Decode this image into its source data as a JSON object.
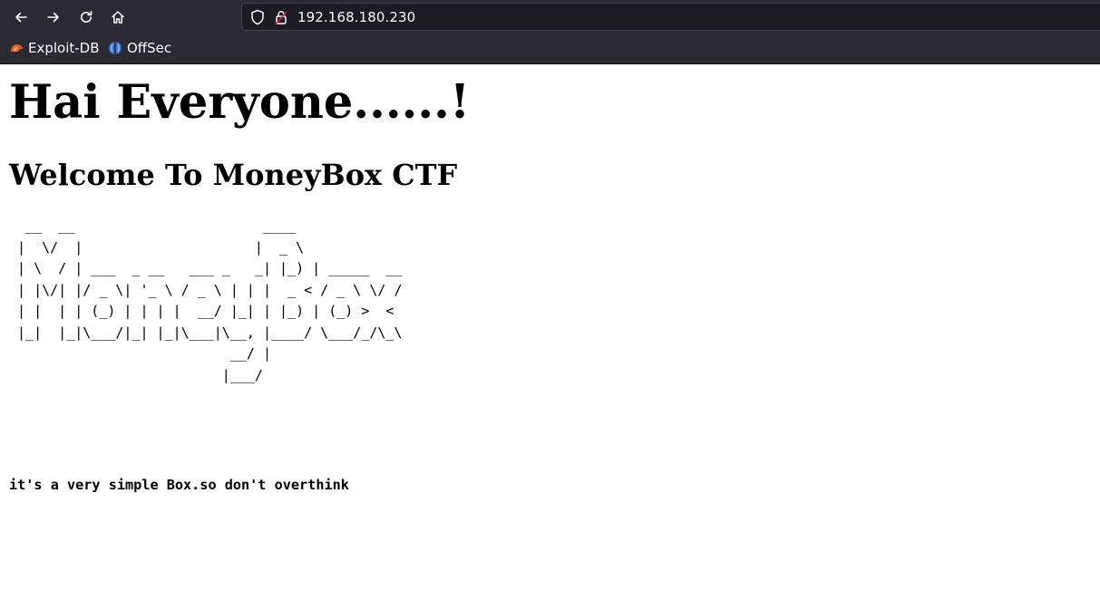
{
  "browser": {
    "url": "192.168.180.230",
    "bookmarks": [
      {
        "label": "Exploit-DB",
        "icon": "exploit-db-icon"
      },
      {
        "label": "OffSec",
        "icon": "offsec-icon"
      }
    ],
    "nav_icons": [
      "back-arrow-icon",
      "forward-arrow-icon",
      "reload-icon",
      "home-icon"
    ],
    "colors": {
      "chrome": "#2b2a33",
      "urlbar": "#1c1b22",
      "text": "#fbfbfe"
    }
  },
  "page": {
    "heading": "Hai Everyone......!",
    "subheading": "Welcome To MoneyBox CTF",
    "ascii_art": "  __  __                       ____\n |  \\/  |                     |  _ \\\n | \\  / | ___  _ __   ___ _   _| |_) | _____  __\n | |\\/| |/ _ \\| '_ \\ / _ \\ | | |  _ < / _ \\ \\/ /\n | |  | | (_) | | | |  __/ |_| | |_) | (_) >  <\n |_|  |_|\\___/|_| |_|\\___|\\__, |____/ \\___/_/\\_\\\n                           __/ |\n                          |___/",
    "note": "it's a very simple Box.so don't overthink"
  }
}
